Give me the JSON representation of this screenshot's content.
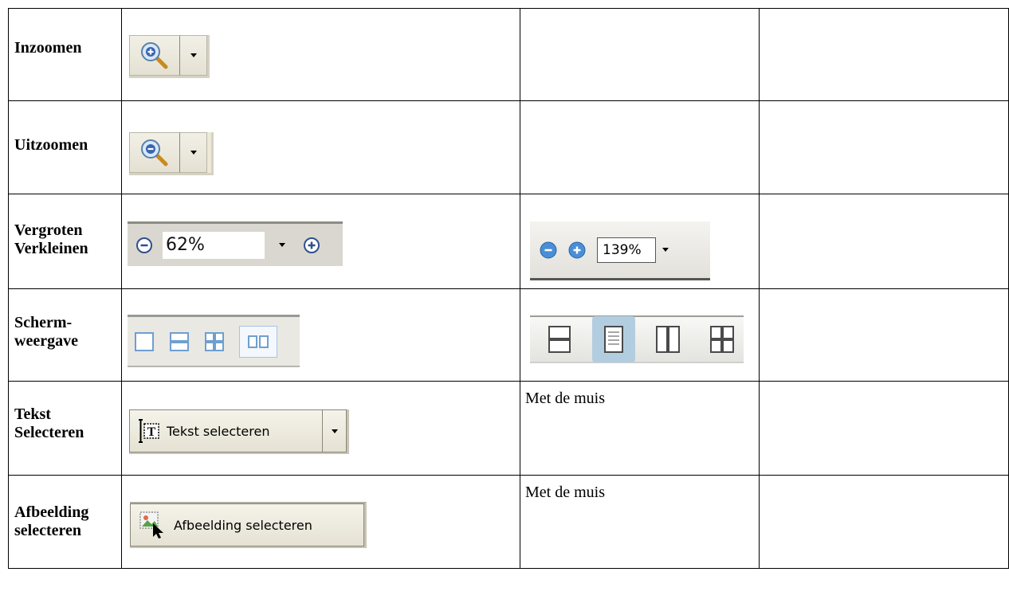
{
  "rows": [
    {
      "label_lines": [
        "Inzoomen"
      ],
      "col3_text": "",
      "widget": {
        "type": "split-button",
        "icon": "zoom-in-icon"
      }
    },
    {
      "label_lines": [
        "Uitzoomen"
      ],
      "col3_text": "",
      "widget": {
        "type": "split-button",
        "icon": "zoom-out-icon"
      }
    },
    {
      "label_lines": [
        "Vergroten",
        "Verkleinen"
      ],
      "col3_text": "",
      "widget": {
        "type": "zoom-bar",
        "value": "62%"
      },
      "widget2": {
        "type": "zoom-bar-2",
        "value": "139%"
      }
    },
    {
      "label_lines": [
        "Scherm-",
        "weergave"
      ],
      "col3_text": "",
      "widget": {
        "type": "view-bar",
        "icons": [
          "single-page-icon",
          "continuous-page-icon",
          "facing-pages-icon",
          "two-up-icon"
        ],
        "active": 3
      },
      "widget2": {
        "type": "view-bar-2",
        "icons": [
          "continuous-page-icon",
          "single-page-icon",
          "two-up-icon",
          "facing-pages-icon"
        ],
        "active": 1
      }
    },
    {
      "label_lines": [
        "Tekst",
        "Selecteren"
      ],
      "col3_text": "Met de muis",
      "widget": {
        "type": "select-tool",
        "icon": "text-select-icon",
        "label": "Tekst selecteren",
        "has_arrow": true
      }
    },
    {
      "label_lines": [
        "Afbeelding",
        "selecteren"
      ],
      "col3_text": "Met de muis",
      "widget": {
        "type": "select-tool",
        "icon": "image-select-icon",
        "label": "Afbeelding selecteren",
        "has_arrow": false
      }
    }
  ]
}
